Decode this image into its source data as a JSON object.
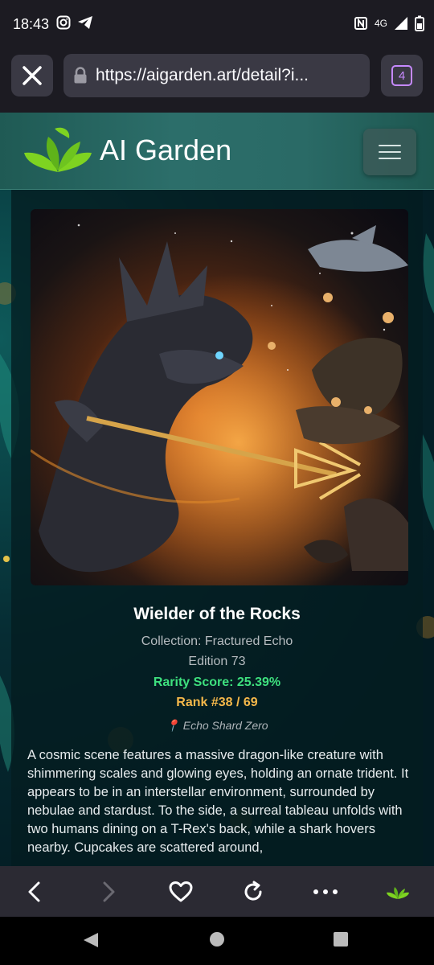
{
  "status_bar": {
    "time": "18:43",
    "icons_left": [
      "instagram-icon",
      "telegram-icon"
    ],
    "network": "4G",
    "icons_right": [
      "nfc-icon",
      "signal-icon",
      "battery-icon"
    ]
  },
  "browser": {
    "url": "https://aigarden.art/detail?i...",
    "tab_count": "4",
    "accent_color": "#c689ff"
  },
  "site": {
    "logo_text": "AI Garden"
  },
  "artwork": {
    "title": "Wielder of the Rocks",
    "collection": "Collection: Fractured Echo",
    "edition": "Edition 73",
    "rarity": "Rarity Score: 25.39%",
    "rank": "Rank #38 / 69",
    "location_pin": "📍",
    "location": "Echo Shard Zero",
    "description": "A cosmic scene features a massive dragon-like creature with shimmering scales and glowing eyes, holding an ornate trident. It appears to be in an interstellar environment, surrounded by nebulae and stardust. To the side, a surreal tableau unfolds with two humans dining on a T-Rex's back, while a shark hovers nearby. Cupcakes are scattered around,"
  },
  "toolbar": {
    "buttons": [
      "back-icon",
      "forward-icon",
      "heart-icon",
      "reload-icon",
      "more-icon",
      "site-logo-icon"
    ]
  },
  "colors": {
    "rarity": "#3ee07e",
    "rank": "#f5b84a",
    "header": "#2c6e6a"
  }
}
